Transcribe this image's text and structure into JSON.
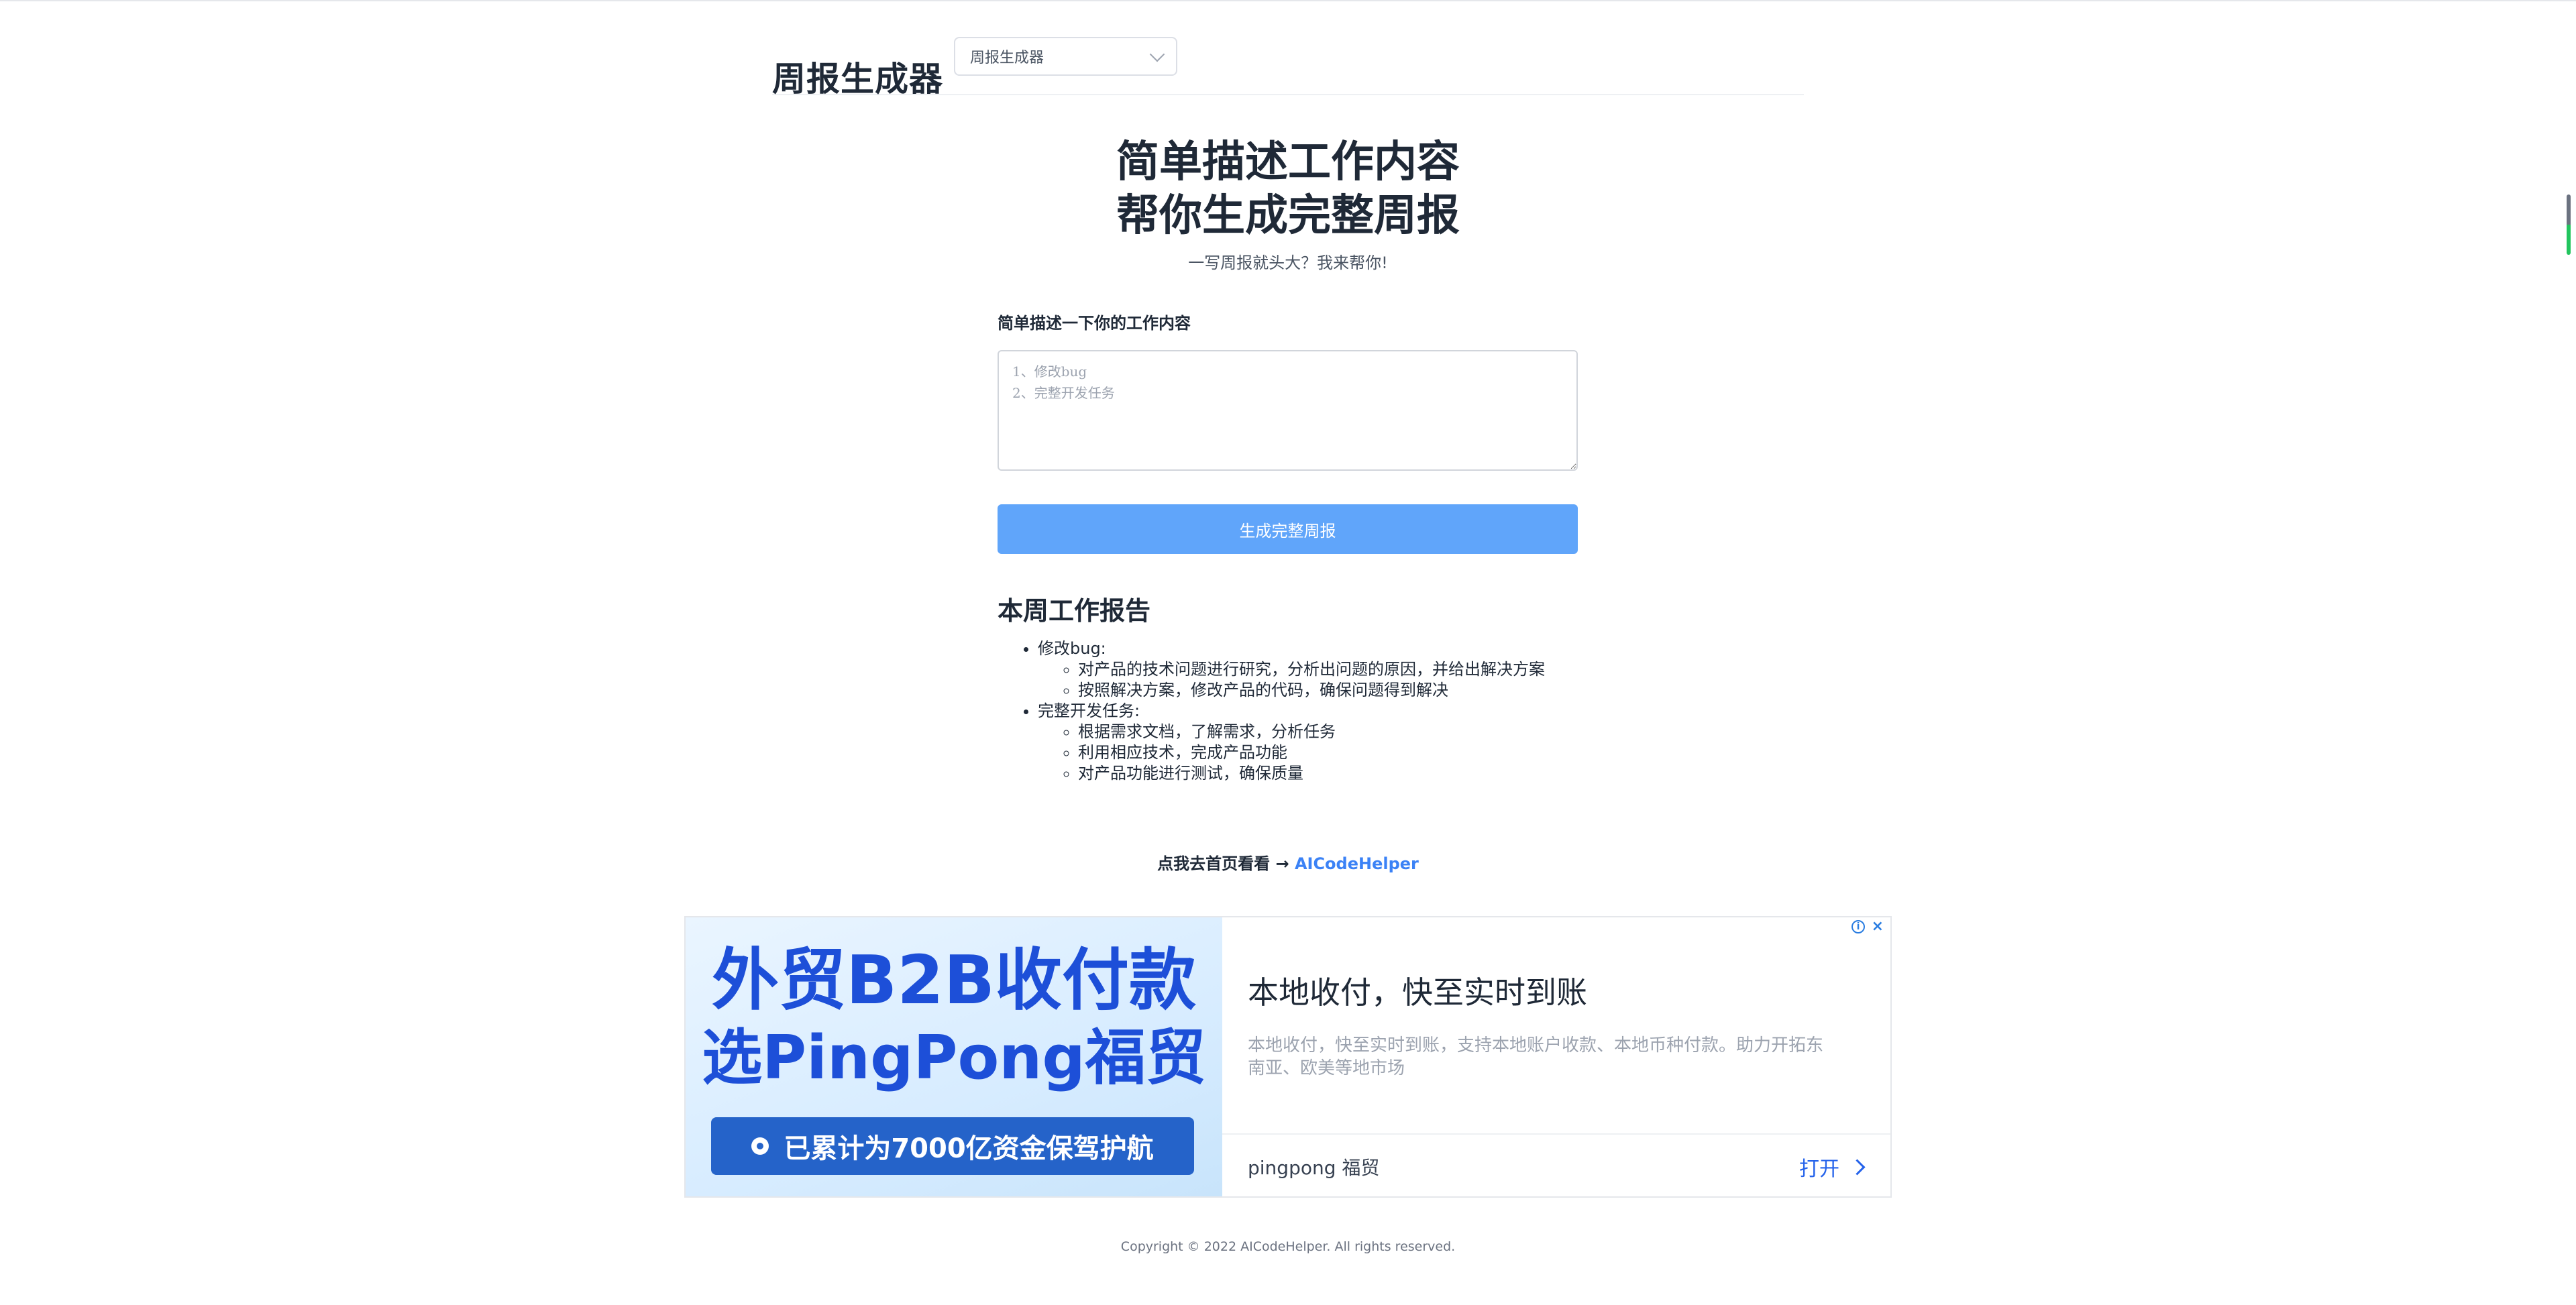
{
  "header": {
    "app_title": "周报生成器",
    "tool_select": {
      "value": "周报生成器"
    }
  },
  "hero": {
    "title_line1": "简单描述工作内容",
    "title_line2": "帮你生成完整周报",
    "subtitle": "一写周报就头大？我来帮你!"
  },
  "form": {
    "label": "简单描述一下你的工作内容",
    "placeholder": "1、修改bug\n2、完整开发任务",
    "generate_label": "生成完整周报"
  },
  "report": {
    "title": "本周工作报告",
    "sections": [
      {
        "title": "修改bug:",
        "items": [
          "对产品的技术问题进行研究，分析出问题的原因，并给出解决方案",
          "按照解决方案，修改产品的代码，确保问题得到解决"
        ]
      },
      {
        "title": "完整开发任务:",
        "items": [
          "根据需求文档，了解需求，分析任务",
          "利用相应技术，完成产品功能",
          "对产品功能进行测试，确保质量"
        ]
      }
    ]
  },
  "home_link": {
    "prefix": "点我去首页看看 →",
    "text": "AICodeHelper"
  },
  "ad": {
    "headline_line1": "外贸B2B收付款",
    "headline_line2": "选PingPong福贸",
    "badge": "已累计为7000亿资金保驾护航",
    "heading": "本地收付，快至实时到账",
    "description": "本地收付，快至实时到账，支持本地账户收款、本地币种付款。助力开拓东南亚、欧美等地市场",
    "advertiser": "pingpong 福贸",
    "open_label": "打开"
  },
  "footer": {
    "copyright": "Copyright © 2022 AICodeHelper. All rights reserved."
  },
  "colors": {
    "primary_button": "#60a5fa",
    "link": "#3b82f6",
    "ad_headline": "#1d4fd8"
  }
}
